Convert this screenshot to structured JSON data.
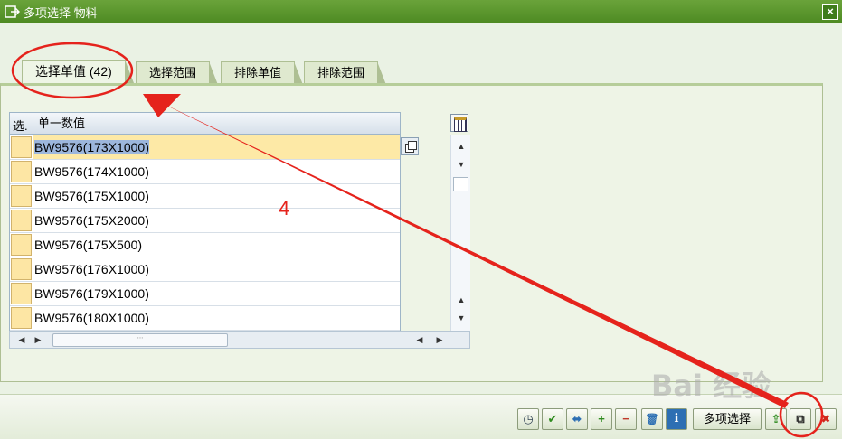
{
  "window": {
    "title": "多项选择 物料",
    "close_label": "×"
  },
  "tabs": [
    {
      "label": "选择单值 (42)",
      "active": true
    },
    {
      "label": "选择范围",
      "active": false
    },
    {
      "label": "排除单值",
      "active": false
    },
    {
      "label": "排除范围",
      "active": false
    }
  ],
  "table": {
    "columns": [
      "选.",
      "单一数值"
    ],
    "rows": [
      "BW9576(173X1000)",
      "BW9576(174X1000)",
      "BW9576(175X1000)",
      "BW9576(175X2000)",
      "BW9576(175X500)",
      "BW9576(176X1000)",
      "BW9576(179X1000)",
      "BW9576(180X1000)"
    ]
  },
  "scroll": {
    "up": "▲",
    "down": "▼",
    "left": "◀",
    "right": "▶",
    "thumb_grip": ":::"
  },
  "toolbar": {
    "buttons": [
      {
        "name": "execute-button",
        "glyph": "◷"
      },
      {
        "name": "check-button",
        "glyph": "✔"
      },
      {
        "name": "copy-entries-button",
        "glyph": "⬌"
      },
      {
        "name": "insert-line-button",
        "glyph": "+"
      },
      {
        "name": "delete-line-button",
        "glyph": "−"
      },
      {
        "name": "delete-all-button",
        "glyph": "🗑"
      },
      {
        "name": "info-button",
        "glyph": "i"
      },
      {
        "name": "import-button",
        "glyph": "⇪"
      },
      {
        "name": "paste-clipboard-button",
        "glyph": "⧉"
      },
      {
        "name": "cancel-button",
        "glyph": "✖"
      }
    ],
    "multi_select_label": "多项选择"
  },
  "annotation": {
    "step_number": "4",
    "color": "#e5231c"
  },
  "watermark": {
    "text": "Bai 经验"
  }
}
